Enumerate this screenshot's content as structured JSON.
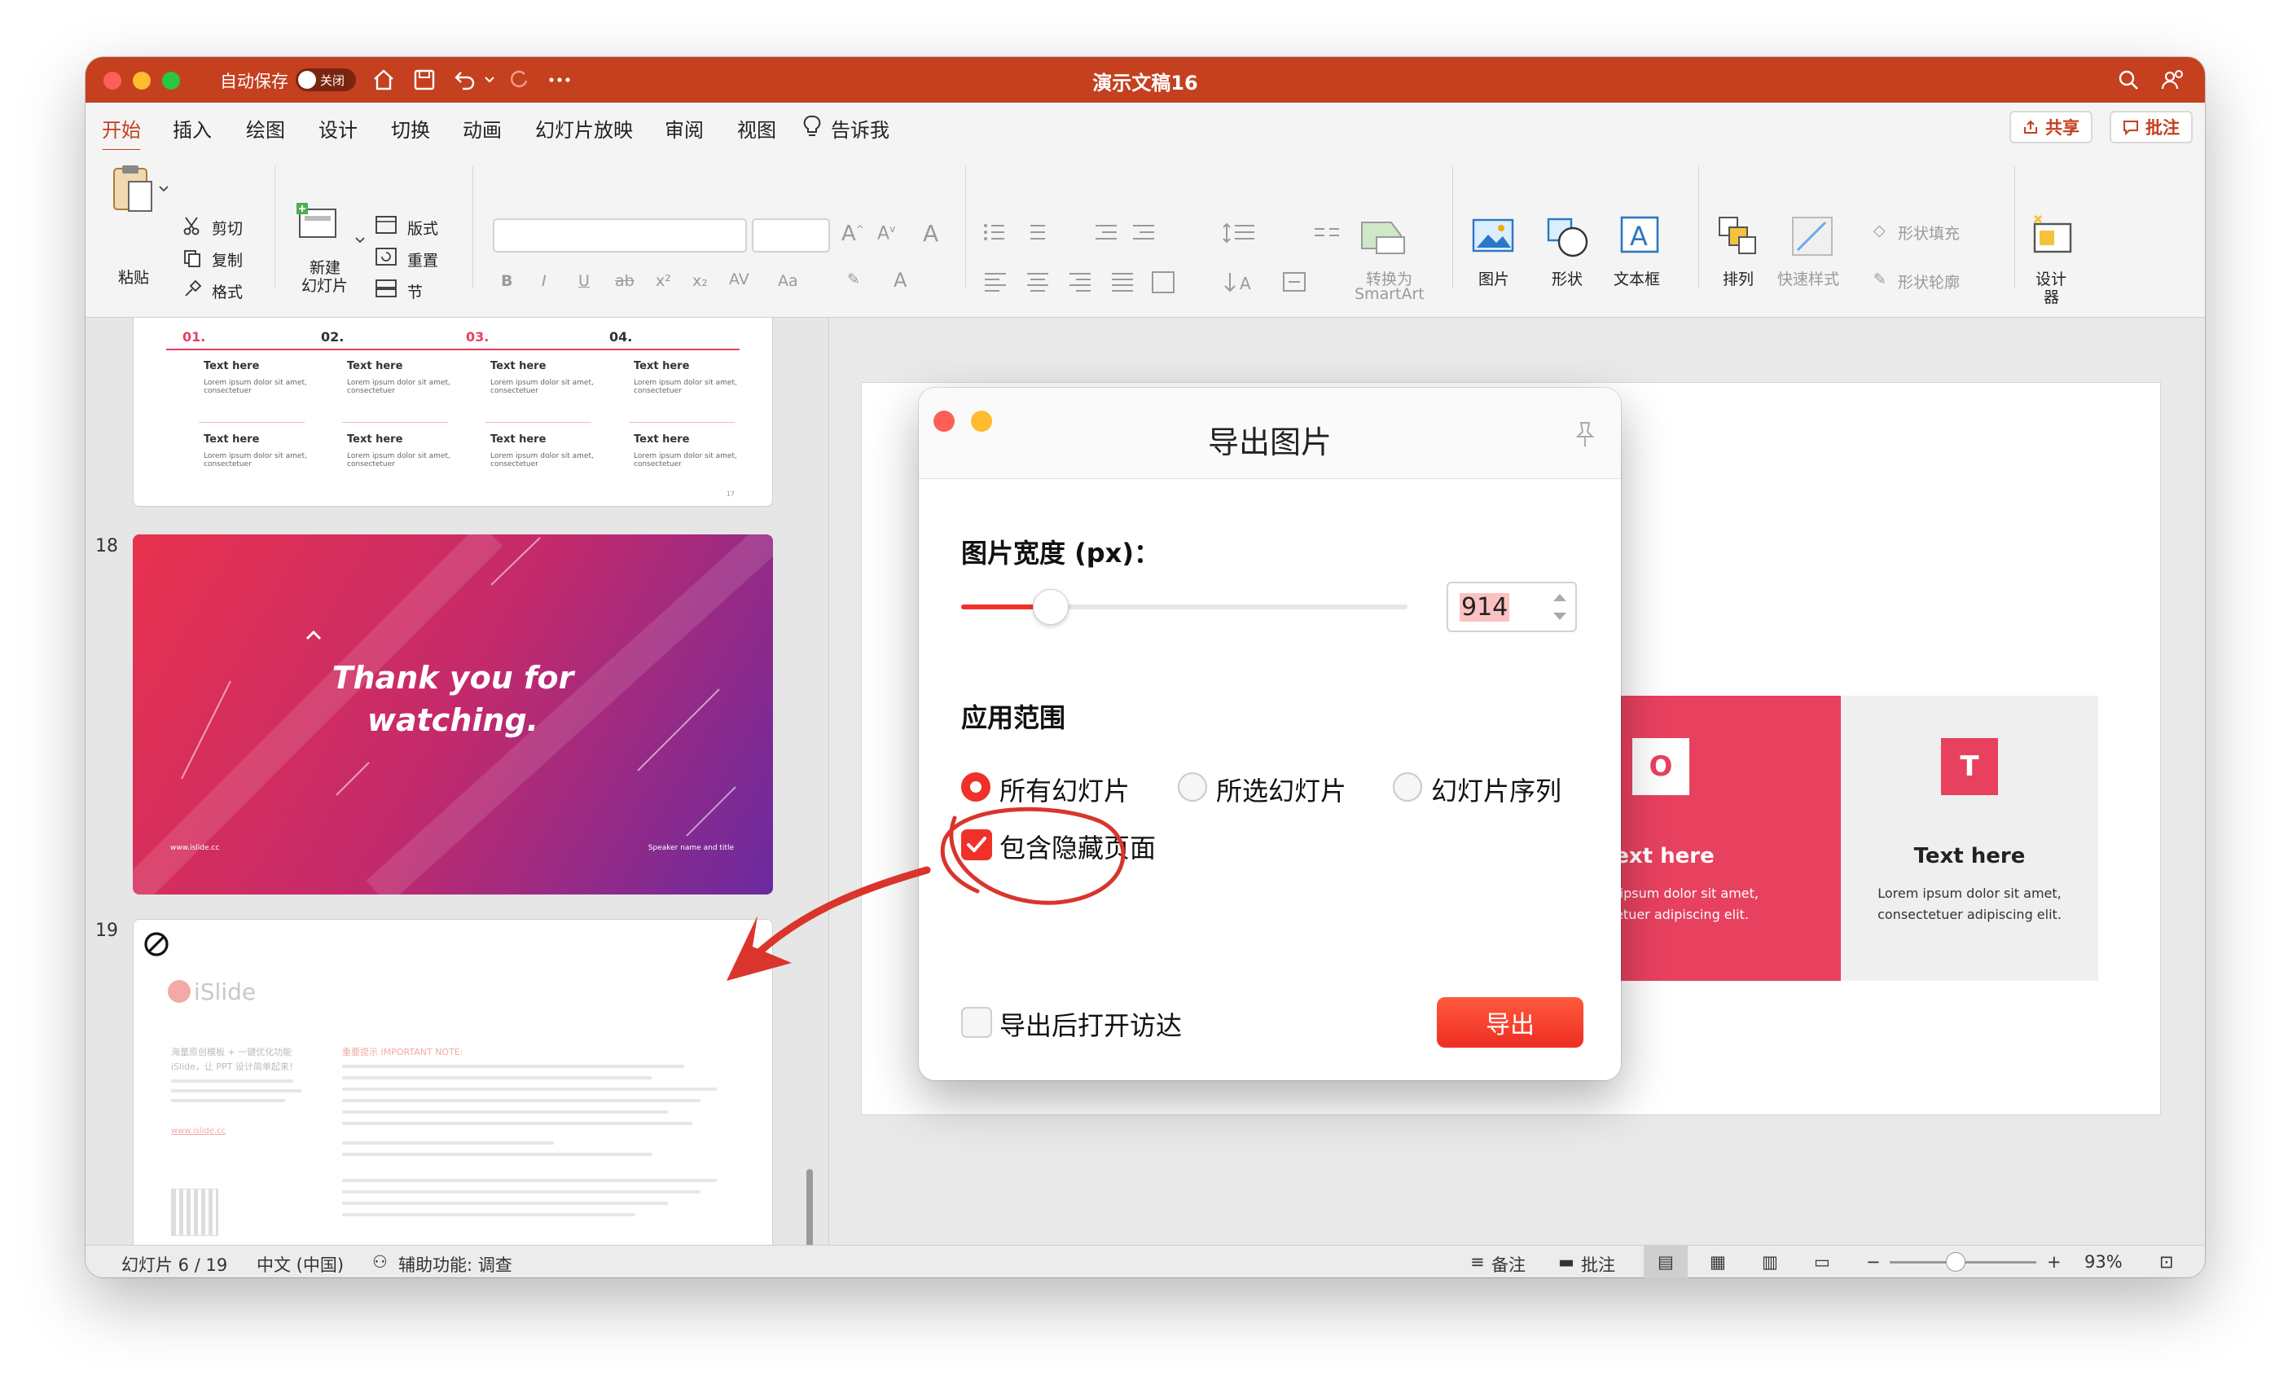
{
  "window": {
    "title": "演示文稿16",
    "autosave_label": "自动保存",
    "autosave_state": "关闭"
  },
  "tabs": [
    "开始",
    "插入",
    "绘图",
    "设计",
    "切换",
    "动画",
    "幻灯片放映",
    "审阅",
    "视图",
    "告诉我"
  ],
  "header_buttons": {
    "share": "共享",
    "comments": "批注"
  },
  "ribbon": {
    "paste": "粘贴",
    "cut": "剪切",
    "copy": "复制",
    "format": "格式",
    "new_slide_1": "新建",
    "new_slide_2": "幻灯片",
    "layout": "版式",
    "reset": "重置",
    "section": "节",
    "smartart_1": "转换为",
    "smartart_2": "SmartArt",
    "picture": "图片",
    "shape": "形状",
    "textbox": "文本框",
    "arrange": "排列",
    "quick_styles": "快速样式",
    "shape_fill": "形状填充",
    "shape_outline": "形状轮廓",
    "designer_1": "设计",
    "designer_2": "器"
  },
  "slides_panel": {
    "slide17": {
      "numbers": [
        "01.",
        "02.",
        "03.",
        "04."
      ],
      "card_title": "Text here",
      "card_body_1": "Lorem ipsum dolor sit amet,",
      "card_body_2": "consectetuer",
      "page": "17"
    },
    "slide18": {
      "number": "18",
      "headline_1": "Thank you for",
      "headline_2": "watching.",
      "footer_left": "www.islide.cc",
      "footer_right": "Speaker name and title"
    },
    "slide19": {
      "number": "19",
      "brand": "iSlide",
      "tagline_1": "海量原创模板 + 一键优化功能",
      "tagline_2": "iSlide，让 PPT 设计简单起来！",
      "note_title": "重要提示 IMPORTANT NOTE:",
      "link": "www.islide.cc"
    }
  },
  "slide_canvas": {
    "card_o_letter": "O",
    "card_o_title": "Text here",
    "card_o_body_1": "m ipsum dolor sit amet,",
    "card_o_body_2": "ctetuer adipiscing elit.",
    "card_t_letter": "T",
    "card_t_title": "Text here",
    "card_t_body_1": "Lorem ipsum dolor sit amet,",
    "card_t_body_2": "consectetuer adipiscing elit."
  },
  "dialog": {
    "title": "导出图片",
    "width_label": "图片宽度 (px)：",
    "width_value": "914",
    "slider_fraction": 0.2,
    "range_label": "应用范围",
    "radio_all": "所有幻灯片",
    "radio_selected": "所选幻灯片",
    "radio_sequence": "幻灯片序列",
    "include_hidden": "包含隐藏页面",
    "open_finder": "导出后打开访达",
    "export_button": "导出"
  },
  "statusbar": {
    "slide_info": "幻灯片 6 / 19",
    "language": "中文 (中国)",
    "accessibility": "辅助功能: 调查",
    "notes": "备注",
    "comments": "批注",
    "zoom": "93%",
    "zoom_fraction": 0.45
  },
  "colors": {
    "accent": "#c4401f",
    "dialog_red": "#f0312a",
    "card_pink": "#e8415f",
    "card_grey": "#efefef",
    "annotation": "#d9352c"
  }
}
